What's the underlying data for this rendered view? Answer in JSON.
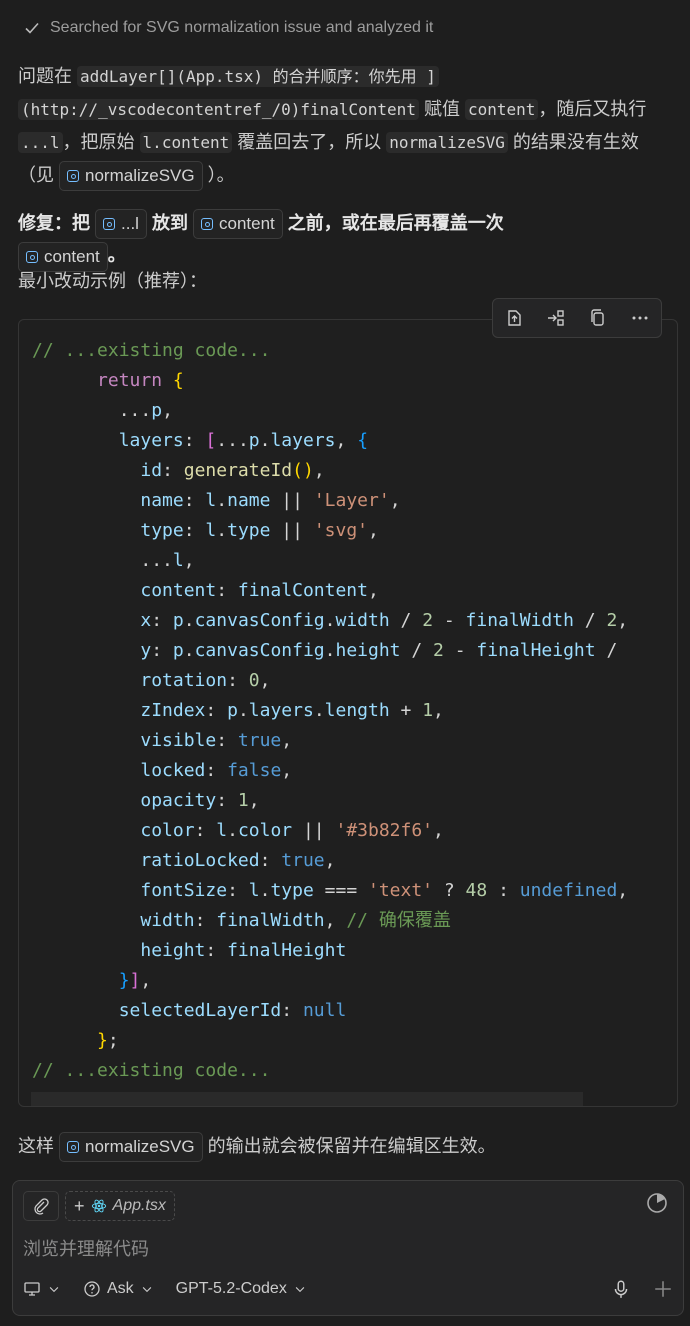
{
  "status": {
    "text": "Searched for SVG normalization issue and analyzed it"
  },
  "explanation": {
    "p1_a": "问题在",
    "p1_code1": "addLayer[](App.tsx) 的合并顺序：你先用 ]",
    "p1_code2": "(http://_vscodecontentref_/0)finalContent",
    "p1_b": "赋值",
    "p1_code3": "content",
    "p1_c": "，随后又执行",
    "p1_code4": "...l",
    "p1_d": "，把原始",
    "p1_code5": "l.content",
    "p1_e": "覆盖回去了，所以",
    "p1_code6": "normalizeSVG",
    "p1_f": "的结果没有生效（见",
    "p1_chip": "normalizeSVG",
    "p1_g": "）。",
    "p2_a": "修复：把",
    "p2_chip1": "...l",
    "p2_b": "放到",
    "p2_chip2": "content",
    "p2_c": "之前，或在最后再覆盖一次",
    "p2_chip3": "content",
    "p2_d": "。",
    "p3": "最小改动示例（推荐）：",
    "p4_a": "这样",
    "p4_chip": "normalizeSVG",
    "p4_b": "的输出就会被保留并在编辑区生效。"
  },
  "code_toolbar": {
    "icons": [
      "apply-in-editor-icon",
      "insert-at-cursor-icon",
      "copy-icon",
      "more-icon"
    ]
  },
  "code": {
    "lines": [
      "// ...existing code...",
      "      return {",
      "        ...p,",
      "        layers: [...p.layers, {",
      "          id: generateId(),",
      "          name: l.name || 'Layer',",
      "          type: l.type || 'svg',",
      "          ...l,",
      "          content: finalContent,",
      "          x: p.canvasConfig.width / 2 - finalWidth / 2,",
      "          y: p.canvasConfig.height / 2 - finalHeight /",
      "          rotation: 0,",
      "          zIndex: p.layers.length + 1,",
      "          visible: true,",
      "          locked: false,",
      "          opacity: 1,",
      "          color: l.color || '#3b82f6',",
      "          ratioLocked: true,",
      "          fontSize: l.type === 'text' ? 48 : undefined,",
      "          width: finalWidth, // 确保覆盖",
      "          height: finalHeight",
      "        }],",
      "        selectedLayerId: null",
      "      };",
      "// ...existing code..."
    ]
  },
  "composer": {
    "attached_file": "App.tsx",
    "placeholder": "浏览并理解代码",
    "mode": "Ask",
    "model": "GPT-5.2-Codex"
  },
  "colors": {
    "background": "#1e1e1e",
    "link_symbol": "#75beff",
    "comment": "#6a9955",
    "string": "#ce9178"
  }
}
